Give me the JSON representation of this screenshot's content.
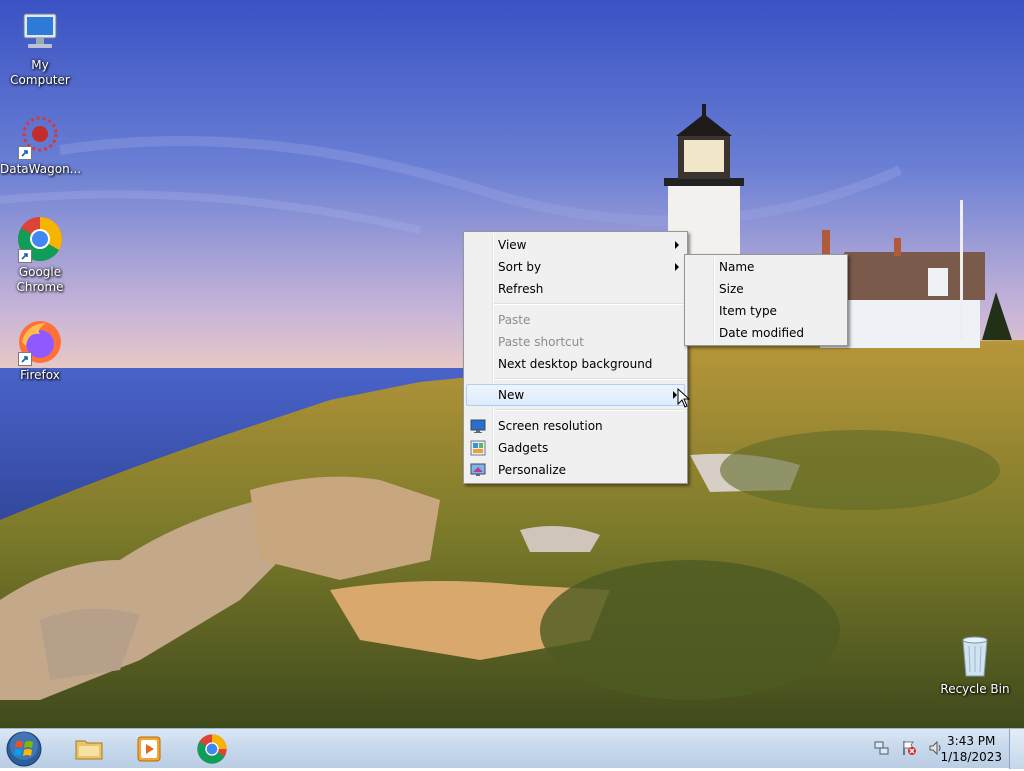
{
  "desktop": {
    "icons": [
      {
        "label": "My Computer",
        "icon": "computer-icon",
        "shortcut": false
      },
      {
        "label": "DataWagon...",
        "icon": "datawagon-icon",
        "shortcut": true
      },
      {
        "label": "Google\nChrome",
        "icon": "chrome-icon",
        "shortcut": true
      },
      {
        "label": "Firefox",
        "icon": "firefox-icon",
        "shortcut": true
      }
    ],
    "recycle_bin": {
      "label": "Recycle Bin",
      "icon": "recycle-bin-icon"
    }
  },
  "context_menu": {
    "items": [
      {
        "label": "View",
        "has_submenu": true,
        "enabled": true
      },
      {
        "label": "Sort by",
        "has_submenu": true,
        "enabled": true
      },
      {
        "label": "Refresh",
        "has_submenu": false,
        "enabled": true
      },
      {
        "label": "Paste",
        "has_submenu": false,
        "enabled": false
      },
      {
        "label": "Paste shortcut",
        "has_submenu": false,
        "enabled": false
      },
      {
        "label": "Next desktop background",
        "has_submenu": false,
        "enabled": true
      },
      {
        "label": "New",
        "has_submenu": true,
        "enabled": true,
        "highlighted": true
      },
      {
        "label": "Screen resolution",
        "icon": "screen-resolution-icon",
        "enabled": true
      },
      {
        "label": "Gadgets",
        "icon": "gadgets-icon",
        "enabled": true
      },
      {
        "label": "Personalize",
        "icon": "personalize-icon",
        "enabled": true
      }
    ]
  },
  "sort_submenu": {
    "items": [
      "Name",
      "Size",
      "Item type",
      "Date modified"
    ]
  },
  "taskbar": {
    "pinned": [
      "file-explorer-icon",
      "media-player-icon",
      "chrome-icon"
    ],
    "clock": {
      "time": "3:43 PM",
      "date": "1/18/2023"
    }
  },
  "colors": {
    "menu_bg": "#f0f0f0",
    "menu_border": "#979797",
    "highlight": "#dcebfc",
    "taskbar": "#c8d9ec"
  }
}
